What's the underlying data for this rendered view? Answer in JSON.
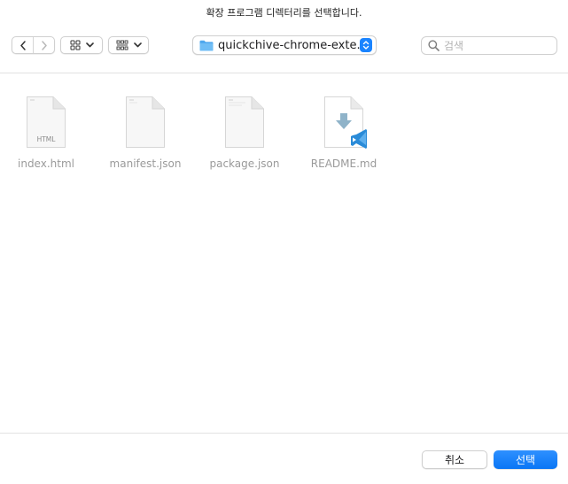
{
  "dialog": {
    "title": "확장 프로그램 디렉터리를 선택합니다."
  },
  "toolbar": {
    "back_icon": "chevron-left-icon",
    "forward_icon": "chevron-right-icon",
    "view_icon": "icon-grid-view-icon",
    "group_icon": "group-by-icon",
    "path": {
      "icon": "folder-icon",
      "label": "quickchive-chrome-exte..."
    },
    "search": {
      "placeholder": "검색",
      "value": ""
    }
  },
  "files": [
    {
      "name": "index.html",
      "kind": "html",
      "badge": "HTML"
    },
    {
      "name": "manifest.json",
      "kind": "json",
      "badge": ""
    },
    {
      "name": "package.json",
      "kind": "json",
      "badge": ""
    },
    {
      "name": "README.md",
      "kind": "markdown-vscode",
      "badge": ""
    }
  ],
  "footer": {
    "cancel_label": "취소",
    "select_label": "선택"
  },
  "colors": {
    "accent": "#1a84ff",
    "folder": "#4fa8ee",
    "vscode": "#2a8bd8"
  }
}
